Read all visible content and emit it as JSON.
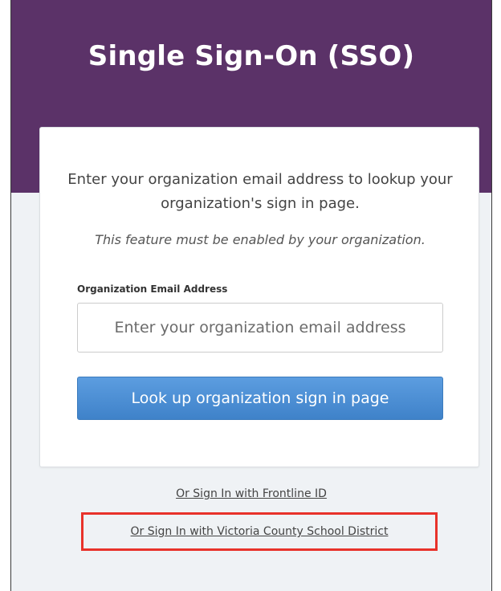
{
  "header": {
    "title": "Single Sign-On (SSO)"
  },
  "card": {
    "intro": "Enter your organization email address to lookup your organization's sign in page.",
    "note": "This feature must be enabled by your organization.",
    "email_label": "Organization Email Address",
    "email_value": "",
    "email_placeholder": "Enter your organization email address",
    "lookup_button": "Look up organization sign in page"
  },
  "links": {
    "frontline": "Or Sign In with Frontline ID",
    "victoria": "Or Sign In with Victoria County School District"
  },
  "colors": {
    "header": "#5b3268",
    "button": "#4a8fd6",
    "highlight": "#e8322a",
    "background": "#eff2f5"
  }
}
